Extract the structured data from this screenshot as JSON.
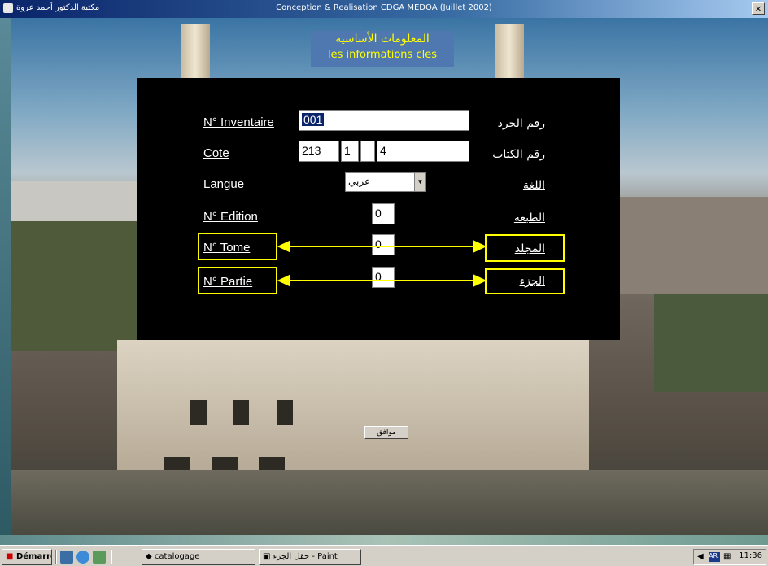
{
  "window": {
    "title_left": "مكتبة الدكتور أحمد عروة",
    "title_center": "Conception & Realisation CDGA MEDOA (Juillet 2002)"
  },
  "header": {
    "arabic": "المعلومات الأساسية",
    "french": "les informations cles"
  },
  "form": {
    "inventaire": {
      "label": "N° Inventaire",
      "value": "001",
      "label_ar": "رقم الجرد"
    },
    "cote": {
      "label": "Cote",
      "part1": "213",
      "part2": "1",
      "part3": "",
      "part4": "4",
      "label_ar": "رقم الكتاب"
    },
    "langue": {
      "label": "Langue",
      "value": "عربي",
      "label_ar": "اللغة"
    },
    "edition": {
      "label": "N° Edition",
      "value": "0",
      "label_ar": "الطبعة"
    },
    "tome": {
      "label": "N° Tome",
      "value": "0",
      "label_ar": "المجلد"
    },
    "partie": {
      "label": "N° Partie",
      "value": "0",
      "label_ar": "الجزء"
    },
    "ok_label": "موافق"
  },
  "taskbar": {
    "start_label": "Démarrer",
    "windows": [
      "catalogage",
      "حقل الجزء - Paint"
    ],
    "lang": "AR",
    "clock": "11:36"
  }
}
